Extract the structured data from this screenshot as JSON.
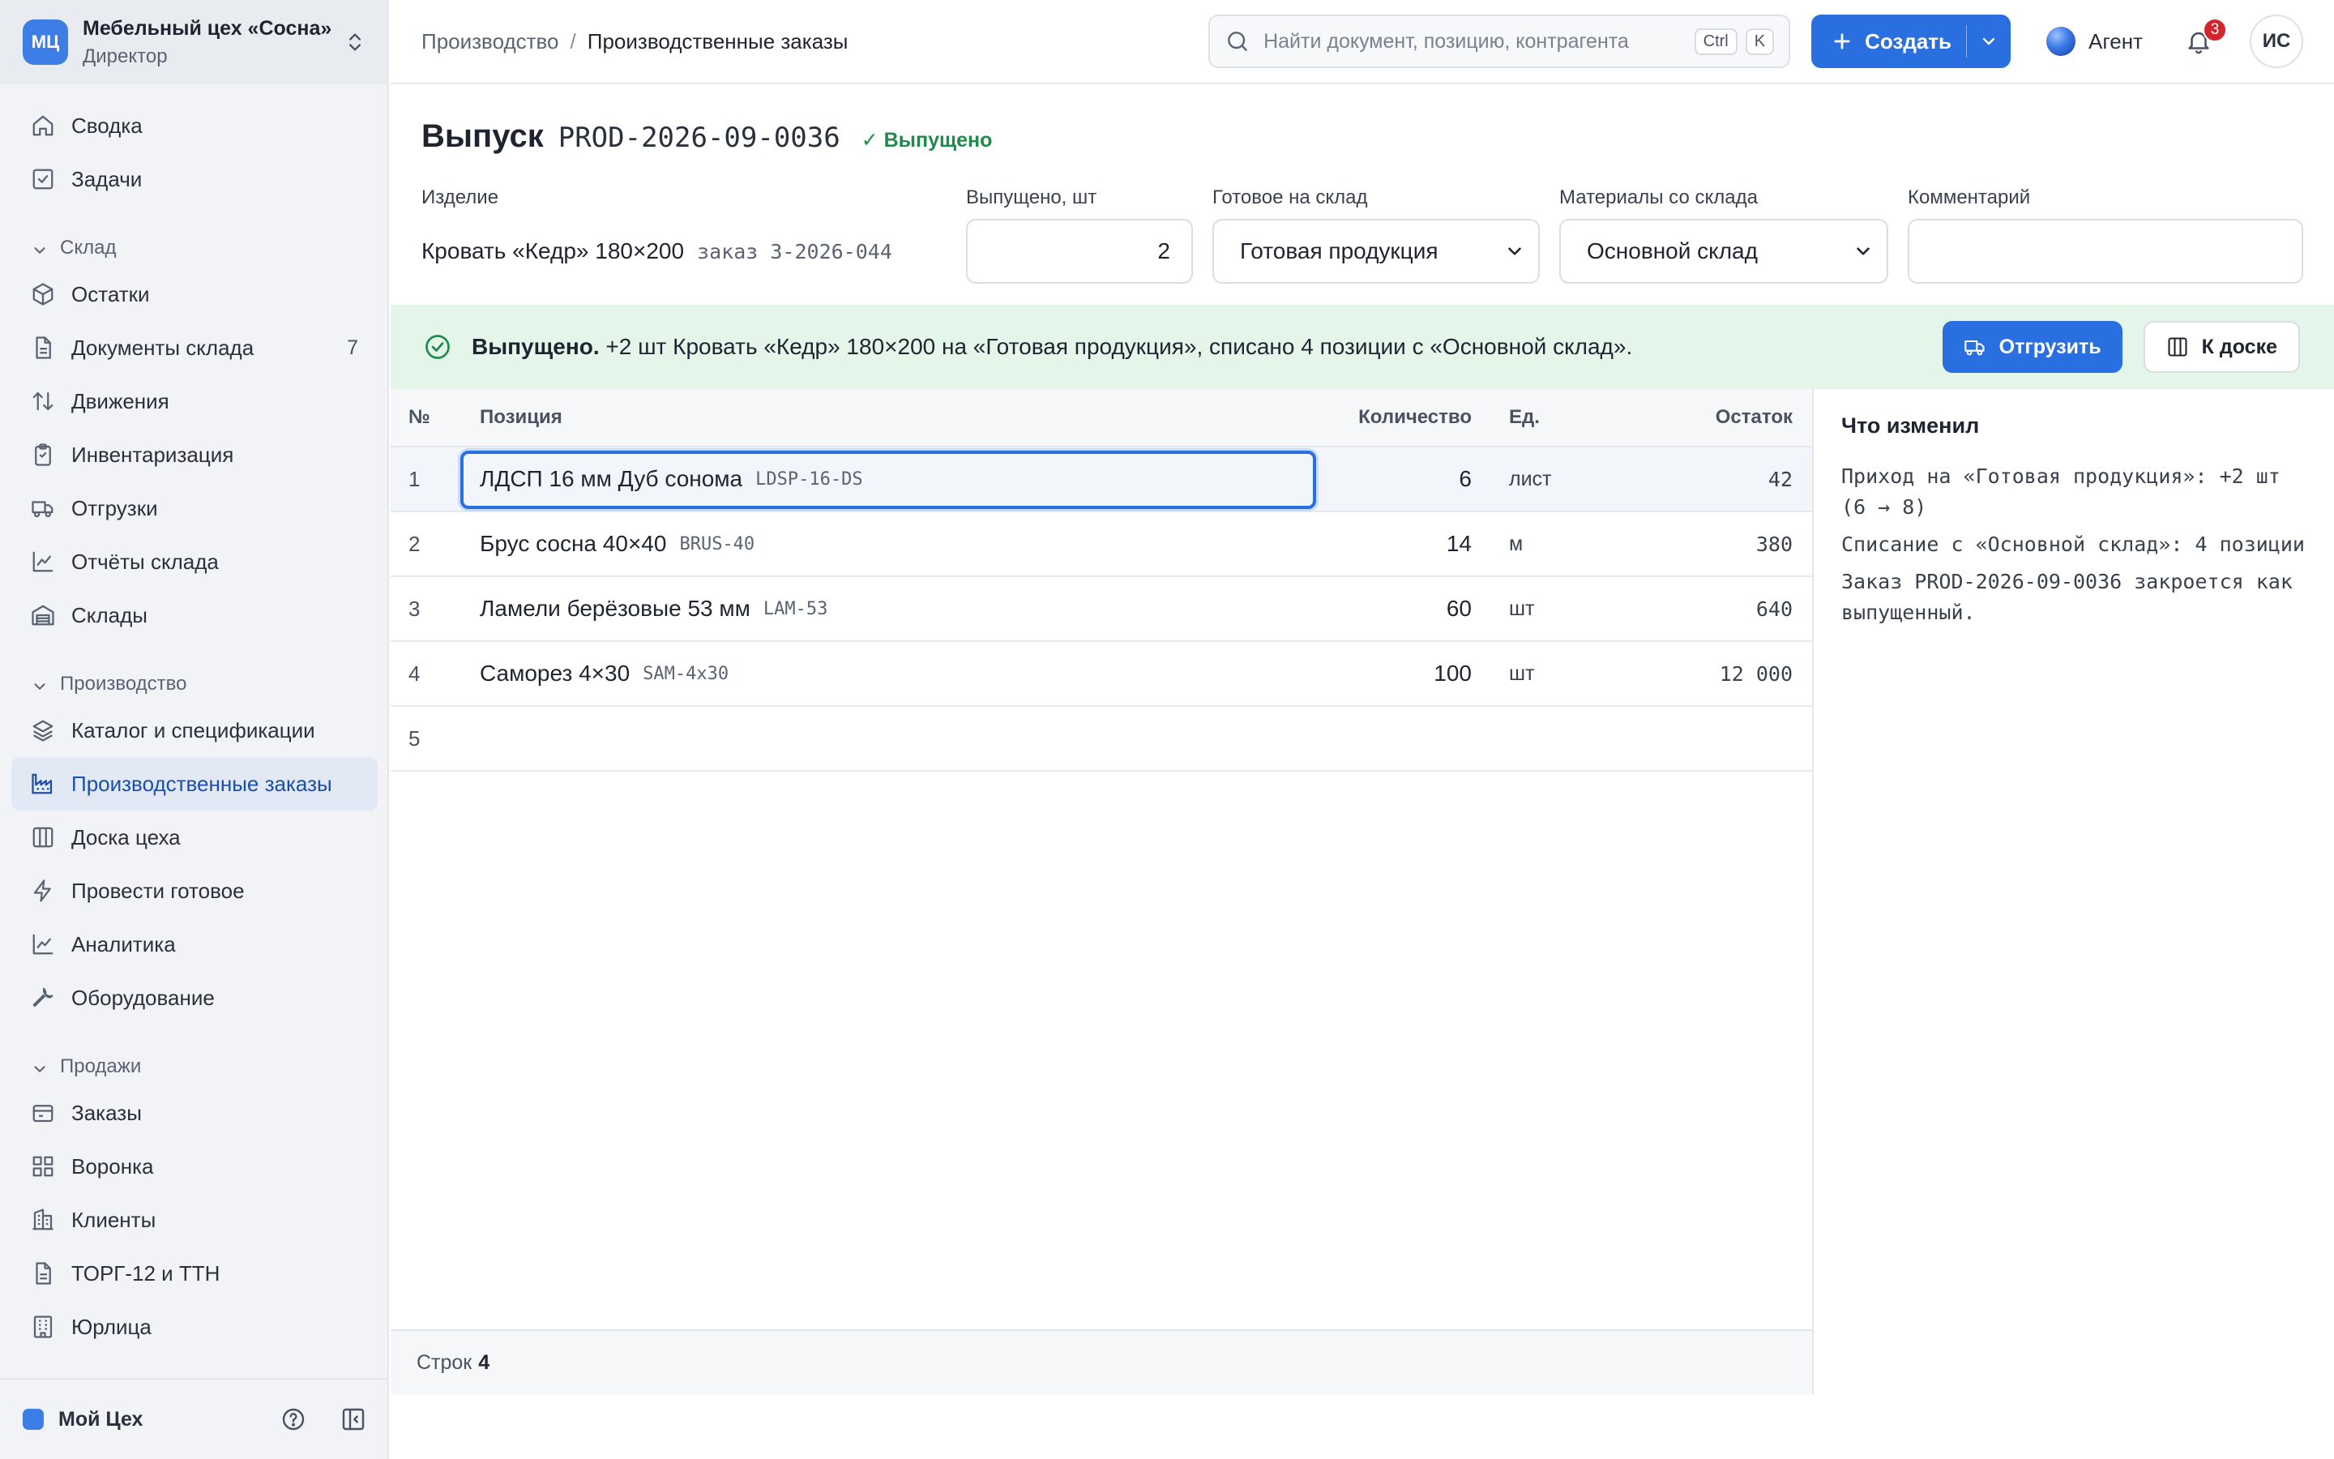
{
  "org": {
    "initials": "МЦ",
    "name": "Мебельный цех «Сосна»",
    "role": "Директор"
  },
  "nav": {
    "top": [
      {
        "label": "Сводка",
        "icon": "home-icon"
      },
      {
        "label": "Задачи",
        "icon": "checkbox-icon"
      }
    ],
    "warehouse": {
      "title": "Склад",
      "items": [
        {
          "label": "Остатки",
          "icon": "box-icon"
        },
        {
          "label": "Документы склада",
          "icon": "document-icon",
          "count": "7"
        },
        {
          "label": "Движения",
          "icon": "arrows-updown-icon"
        },
        {
          "label": "Инвентаризация",
          "icon": "clipboard-icon"
        },
        {
          "label": "Отгрузки",
          "icon": "truck-icon"
        },
        {
          "label": "Отчёты склада",
          "icon": "line-chart-icon"
        },
        {
          "label": "Склады",
          "icon": "warehouse-icon"
        }
      ]
    },
    "production": {
      "title": "Производство",
      "items": [
        {
          "label": "Каталог и спецификации",
          "icon": "layers-icon"
        },
        {
          "label": "Производственные заказы",
          "icon": "factory-icon",
          "active": true
        },
        {
          "label": "Доска цеха",
          "icon": "columns-icon"
        },
        {
          "label": "Провести готовое",
          "icon": "lightning-icon"
        },
        {
          "label": "Аналитика",
          "icon": "line-chart-icon"
        },
        {
          "label": "Оборудование",
          "icon": "wrench-icon"
        }
      ]
    },
    "sales": {
      "title": "Продажи",
      "items": [
        {
          "label": "Заказы",
          "icon": "receipt-icon"
        },
        {
          "label": "Воронка",
          "icon": "grid-icon"
        },
        {
          "label": "Клиенты",
          "icon": "building-icon"
        },
        {
          "label": "ТОРГ-12 и ТТН",
          "icon": "document-icon"
        },
        {
          "label": "Юрлица",
          "icon": "office-icon"
        }
      ]
    }
  },
  "footer": {
    "workspace": "Мой Цех"
  },
  "topbar": {
    "breadcrumb_parent": "Производство",
    "breadcrumb_separator": "/",
    "breadcrumb_current": "Производственные заказы",
    "search_placeholder": "Найти документ, позицию, контрагента",
    "kbd_ctrl": "Ctrl",
    "kbd_k": "K",
    "create_label": "Создать",
    "agent_label": "Агент",
    "notifications_count": "3",
    "user_initials": "ИС"
  },
  "doc": {
    "title": "Выпуск",
    "number": "PROD-2026-09-0036",
    "status": "✓ Выпущено"
  },
  "form": {
    "product_label": "Изделие",
    "product_value": "Кровать «Кедр» 180×200",
    "product_order": "заказ З-2026-044",
    "qty_label": "Выпущено, шт",
    "qty_value": "2",
    "target_label": "Готовое на склад",
    "target_value": "Готовая продукция",
    "source_label": "Материалы со склада",
    "source_value": "Основной склад",
    "comment_label": "Комментарий",
    "comment_value": ""
  },
  "banner": {
    "lead": "Выпущено.",
    "text": "+2 шт Кровать «Кедр» 180×200 на «Готовая продукция», списано 4 позиции с «Основной склад».",
    "ship_label": "Отгрузить",
    "board_label": "К доске"
  },
  "table": {
    "headers": {
      "num": "№",
      "position": "Позиция",
      "qty": "Количество",
      "unit": "Ед.",
      "rest": "Остаток"
    },
    "rows": [
      {
        "num": "1",
        "name": "ЛДСП 16 мм Дуб сонома",
        "code": "LDSP-16-DS",
        "qty": "6",
        "unit": "лист",
        "rest": "42"
      },
      {
        "num": "2",
        "name": "Брус сосна 40×40",
        "code": "BRUS-40",
        "qty": "14",
        "unit": "м",
        "rest": "380"
      },
      {
        "num": "3",
        "name": "Ламели берёзовые 53 мм",
        "code": "LAM-53",
        "qty": "60",
        "unit": "шт",
        "rest": "640"
      },
      {
        "num": "4",
        "name": "Саморез 4×30",
        "code": "SAM-4x30",
        "qty": "100",
        "unit": "шт",
        "rest": "12 000"
      },
      {
        "num": "5",
        "name": "",
        "code": "",
        "qty": "",
        "unit": "",
        "rest": ""
      }
    ],
    "footer_label": "Строк",
    "footer_count": "4"
  },
  "changes": {
    "title": "Что изменил",
    "lines": [
      "Приход на «Готовая продукция»: +2 шт (6 → 8)",
      "Списание с «Основной склад»: 4 позиции",
      "Заказ PROD-2026-09-0036 закроется как выпущенный."
    ]
  },
  "colors": {
    "accent": "#2a6fe0",
    "success": "#1f8a4c",
    "banner_bg": "#e3f6e9",
    "badge": "#d3262c"
  }
}
